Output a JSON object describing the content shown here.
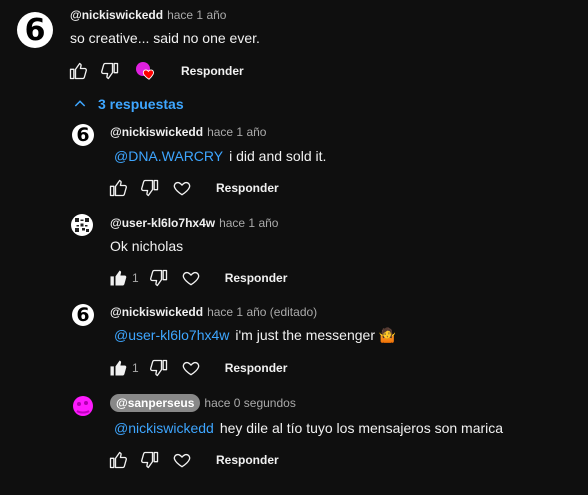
{
  "top_comment": {
    "author": "@nickiswickedd",
    "time": "hace 1 año",
    "text": "so creative... said no one ever.",
    "reply_label": "Responder",
    "avatar_glyph": "6"
  },
  "replies_toggle": {
    "label": "3 respuestas"
  },
  "replies": [
    {
      "author": "@nickiswickedd",
      "time": "hace 1 año",
      "mention": "@DNA.WARCRY",
      "text": "i did and sold it.",
      "like_count": "",
      "reply_label": "Responder",
      "avatar_glyph": "6"
    },
    {
      "author": "@user-kl6lo7hx4w",
      "time": "hace 1 año",
      "mention": "",
      "text": "Ok nicholas",
      "like_count": "1",
      "reply_label": "Responder",
      "avatar_glyph": ""
    },
    {
      "author": "@nickiswickedd",
      "time": "hace 1 año (editado)",
      "mention": "@user-kl6lo7hx4w",
      "text": "i'm just the messenger 🤷",
      "like_count": "1",
      "reply_label": "Responder",
      "avatar_glyph": "6"
    },
    {
      "author": "@sanperseus",
      "time": "hace 0 segundos",
      "mention": "@nickiswickedd",
      "text": "hey dile al tío tuyo los mensajeros son marica",
      "like_count": "",
      "reply_label": "Responder",
      "avatar_glyph": ""
    }
  ],
  "colors": {
    "background": "#0f0f0f",
    "link": "#3ea6ff",
    "owner_badge": "#888888"
  }
}
